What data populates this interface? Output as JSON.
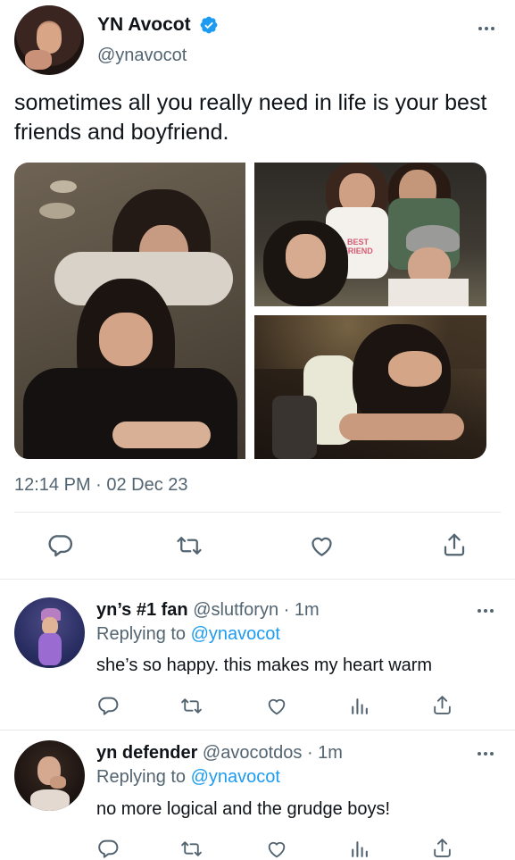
{
  "tweet": {
    "author_name": "YN Avocot",
    "author_handle": "@ynavocot",
    "text": "sometimes all you really need in life is your best friends and boyfriend.",
    "photo_sticker_text": "BEST FRIEND",
    "timestamp": "12:14 PM · 02 Dec 23"
  },
  "replies": [
    {
      "name": "yn’s #1 fan",
      "handle": "@slutforyn",
      "time": "· 1m",
      "replying_label": "Replying to",
      "replying_to": "@ynavocot",
      "text": "she’s so happy. this makes my heart warm"
    },
    {
      "name": "yn defender",
      "handle": "@avocotdos",
      "time": "· 1m",
      "replying_label": "Replying to",
      "replying_to": "@ynavocot",
      "text": "no more logical and the grudge boys!"
    }
  ],
  "icons": {
    "verified": "verified-badge-icon",
    "more": "more-icon",
    "reply": "reply-icon",
    "retweet": "retweet-icon",
    "like": "heart-icon",
    "share": "share-icon",
    "analytics": "analytics-icon"
  },
  "colors": {
    "link": "#1d9bf0",
    "muted": "#536471",
    "text": "#0f1419"
  }
}
